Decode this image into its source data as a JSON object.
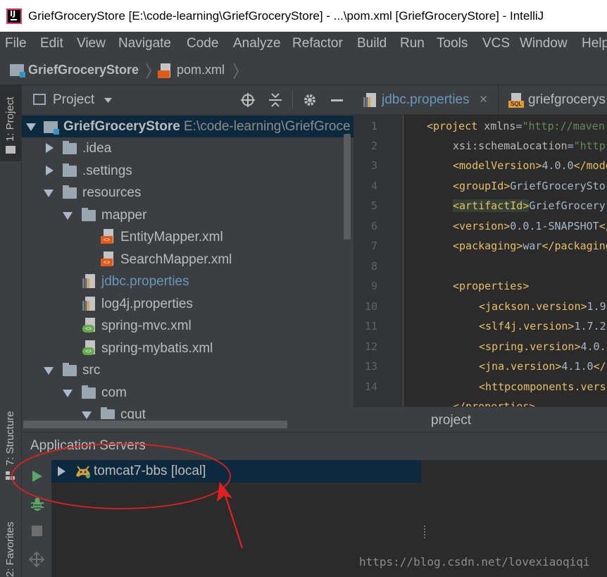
{
  "window": {
    "title": "GriefGroceryStore [E:\\code-learning\\GriefGroceryStore] - ...\\pom.xml [GriefGroceryStore] - IntelliJ"
  },
  "menu": [
    "File",
    "Edit",
    "View",
    "Navigate",
    "Code",
    "Analyze",
    "Refactor",
    "Build",
    "Run",
    "Tools",
    "VCS",
    "Window",
    "Help"
  ],
  "breadcrumb": {
    "project": "GriefGroceryStore",
    "file": "pom.xml"
  },
  "left_stripe": {
    "project_tab": "1: Project",
    "structure_tab": "7: Structure",
    "favorites_tab": "2: Favorites"
  },
  "project_panel": {
    "title": "Project",
    "tree": [
      {
        "label": "GriefGroceryStore",
        "path": "E:\\code-learning\\GriefGroce"
      },
      {
        "label": ".idea"
      },
      {
        "label": ".settings"
      },
      {
        "label": "resources"
      },
      {
        "label": "mapper"
      },
      {
        "label": "EntityMapper.xml"
      },
      {
        "label": "SearchMapper.xml"
      },
      {
        "label": "jdbc.properties"
      },
      {
        "label": "log4j.properties"
      },
      {
        "label": "spring-mvc.xml"
      },
      {
        "label": "spring-mybatis.xml"
      },
      {
        "label": "src"
      },
      {
        "label": "com"
      },
      {
        "label": "cqut"
      }
    ]
  },
  "editor": {
    "tabs": [
      {
        "label": "jdbc.properties",
        "close": "×"
      },
      {
        "label": "griefgrocerys"
      }
    ],
    "line_numbers": [
      "1",
      "2",
      "3",
      "4",
      "5",
      "6",
      "7",
      "8",
      "9",
      "10",
      "11",
      "12",
      "13",
      "14"
    ],
    "code": {
      "l1_tag": "<project ",
      "l1_attr": "xmlns",
      "l1_eq": "=",
      "l1_val": "\"http://maven.",
      "l2_attr": "xsi:schemaLocation",
      "l2_eq": "=",
      "l2_val": "\"http",
      "l3_open": "<modelVersion>",
      "l3_text": "4.0.0",
      "l3_close": "</mode",
      "l4_open": "<groupId>",
      "l4_text": "GriefGroceryStor",
      "l5_open": "<artifactId>",
      "l5_text": "GriefGrocery",
      "l6_open": "<version>",
      "l6_text": "0.0.1-SNAPSHOT",
      "l6_close": "</",
      "l7_open": "<packaging>",
      "l7_text": "war",
      "l7_close": "</packaging",
      "l9_open": "<properties>",
      "l10_open": "<jackson.version>",
      "l10_text": "1.9.",
      "l11_open": "<slf4j.version>",
      "l11_text": "1.7.2",
      "l12_open": "<spring.version>",
      "l12_text": "4.0.2",
      "l13_open": "<jna.version>",
      "l13_text": "4.1.0",
      "l13_close": "</",
      "l14_open": "<httpcomponents.versi",
      "l15_close": "</properties>"
    },
    "footer_breadcrumb": "project"
  },
  "app_servers": {
    "title": "Application Servers",
    "server": "tomcat7-bbs [local]"
  },
  "watermark": "https://blog.csdn.net/lovexiaoqiqi",
  "colors": {
    "background": "#3c3f41",
    "editor_bg": "#2b2b2b",
    "selection": "#0d293e",
    "annotation": "#e02020",
    "link_file": "#6897bb",
    "run_green": "#59a869"
  }
}
